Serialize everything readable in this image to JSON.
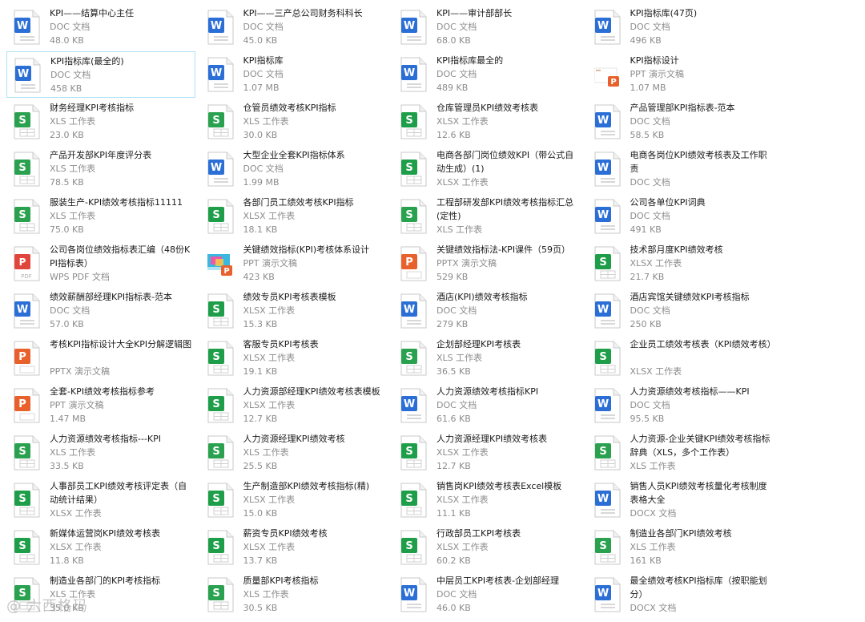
{
  "files": [
    {
      "name": "KPI——结算中心主任",
      "type": "DOC 文档",
      "size": "48.0 KB",
      "icon": "word-icon"
    },
    {
      "name": "KPI——三产总公司财务科科长",
      "type": "DOC 文档",
      "size": "45.0 KB",
      "icon": "word-icon"
    },
    {
      "name": "KPI——审计部部长",
      "type": "DOC 文档",
      "size": "68.0 KB",
      "icon": "word-icon"
    },
    {
      "name": "KPI指标库(47页)",
      "type": "DOC 文档",
      "size": "496 KB",
      "icon": "word-icon"
    },
    {
      "name": "KPI指标库(最全的)",
      "type": "DOC 文档",
      "size": "458 KB",
      "icon": "word-icon",
      "selected": true
    },
    {
      "name": "KPI指标库",
      "type": "DOC 文档",
      "size": "1.07 MB",
      "icon": "word-icon"
    },
    {
      "name": "KPI指标库最全的",
      "type": "DOC 文档",
      "size": "489 KB",
      "icon": "word-icon"
    },
    {
      "name": "KPI指标设计",
      "type": "PPT 演示文稿",
      "size": "1.07 MB",
      "icon": "ppt-thumb-icon"
    },
    {
      "name": "财务经理KPI考核指标",
      "type": "XLS 工作表",
      "size": "23.0 KB",
      "icon": "excel-icon"
    },
    {
      "name": "仓管员绩效考核KPI指标",
      "type": "XLS 工作表",
      "size": "30.0 KB",
      "icon": "excel-icon"
    },
    {
      "name": "仓库管理员KPI绩效考核表",
      "type": "XLSX 工作表",
      "size": "12.6 KB",
      "icon": "excel-green-icon"
    },
    {
      "name": "产品管理部KPI指标表-范本",
      "type": "DOC 文档",
      "size": "58.5 KB",
      "icon": "word-icon"
    },
    {
      "name": "产品开发部KPI年度评分表",
      "type": "XLS 工作表",
      "size": "78.5 KB",
      "icon": "excel-icon"
    },
    {
      "name": "大型企业全套KPI指标体系",
      "type": "DOC 文档",
      "size": "1.99 MB",
      "icon": "word-icon"
    },
    {
      "name": "电商各部门岗位绩效KPI（带公式自动生成）(1)",
      "type": "XLSX 工作表",
      "size": "",
      "icon": "excel-green-icon"
    },
    {
      "name": "电商各岗位KPI绩效考核表及工作职责",
      "type": "DOC 文档",
      "size": "",
      "icon": "word-icon"
    },
    {
      "name": "服装生产-KPI绩效考核指标11111",
      "type": "XLS 工作表",
      "size": "75.0 KB",
      "icon": "excel-icon"
    },
    {
      "name": "各部门员工绩效考核KPI指标",
      "type": "XLSX 工作表",
      "size": "18.1 KB",
      "icon": "excel-green-icon"
    },
    {
      "name": "工程部研发部KPI绩效考核指标汇总(定性)",
      "type": "XLS 工作表",
      "size": "",
      "icon": "excel-icon"
    },
    {
      "name": "公司各单位KPI词典",
      "type": "DOC 文档",
      "size": "491 KB",
      "icon": "word-icon"
    },
    {
      "name": "公司各岗位绩效指标表汇编（48份KPI指标表）",
      "type": "WPS PDF 文档",
      "size": "",
      "icon": "pdf-icon"
    },
    {
      "name": "关键绩效指标(KPI)考核体系设计",
      "type": "PPT 演示文稿",
      "size": "423 KB",
      "icon": "ppt-thumb2-icon"
    },
    {
      "name": "关键绩效指标法-KPI课件（59页）",
      "type": "PPTX 演示文稿",
      "size": "529 KB",
      "icon": "pptx-icon"
    },
    {
      "name": "技术部月度KPI绩效考核",
      "type": "XLSX 工作表",
      "size": "21.7 KB",
      "icon": "excel-green-icon"
    },
    {
      "name": "绩效薪酬部经理KPI指标表-范本",
      "type": "DOC 文档",
      "size": "57.0 KB",
      "icon": "word-icon"
    },
    {
      "name": "绩效专员KPI考核表模板",
      "type": "XLSX 工作表",
      "size": "15.3 KB",
      "icon": "excel-green-icon"
    },
    {
      "name": "酒店(KPI)绩效考核指标",
      "type": "DOC 文档",
      "size": "279 KB",
      "icon": "word-icon"
    },
    {
      "name": "酒店宾馆关键绩效KPI考核指标",
      "type": "DOC 文档",
      "size": "250 KB",
      "icon": "word-icon"
    },
    {
      "name": "考核KPI指标设计大全KPI分解逻辑图",
      "type": "PPTX 演示文稿",
      "size": "",
      "icon": "pptx-icon"
    },
    {
      "name": "客服专员KPI考核表",
      "type": "XLSX 工作表",
      "size": "19.1 KB",
      "icon": "excel-green-icon"
    },
    {
      "name": "企划部经理KPI考核表",
      "type": "XLS 工作表",
      "size": "36.5 KB",
      "icon": "excel-icon"
    },
    {
      "name": "企业员工绩效考核表（KPI绩效考核）",
      "type": "XLSX 工作表",
      "size": "",
      "icon": "excel-green-icon"
    },
    {
      "name": "全套-KPI绩效考核指标参考",
      "type": "PPT 演示文稿",
      "size": "1.47 MB",
      "icon": "ppt-icon"
    },
    {
      "name": "人力资源部经理KPI绩效考核表模板",
      "type": "XLSX 工作表",
      "size": "12.7 KB",
      "icon": "excel-green-icon"
    },
    {
      "name": "人力资源绩效考核指标KPI",
      "type": "DOC 文档",
      "size": "61.6 KB",
      "icon": "word-icon"
    },
    {
      "name": "人力资源绩效考核指标——KPI",
      "type": "DOC 文档",
      "size": "95.5 KB",
      "icon": "word-icon"
    },
    {
      "name": "人力资源绩效考核指标---KPI",
      "type": "XLS 工作表",
      "size": "33.5 KB",
      "icon": "excel-icon"
    },
    {
      "name": "人力资源经理KPI绩效考核",
      "type": "XLS 工作表",
      "size": "25.5 KB",
      "icon": "excel-icon"
    },
    {
      "name": "人力资源经理KPI绩效考核表",
      "type": "XLSX 工作表",
      "size": "12.7 KB",
      "icon": "excel-green-icon"
    },
    {
      "name": "人力资源-企业关键KPI绩效考核指标辞典（XLS，多个工作表）",
      "type": "XLS 工作表",
      "size": "",
      "icon": "excel-icon"
    },
    {
      "name": "人事部员工KPI绩效考核评定表（自动统计结果）",
      "type": "XLSX 工作表",
      "size": "",
      "icon": "excel-green-icon"
    },
    {
      "name": "生产制造部KPI绩效考核指标(精)",
      "type": "XLSX 工作表",
      "size": "15.0 KB",
      "icon": "excel-green-icon"
    },
    {
      "name": "销售岗KPI绩效考核表Excel模板",
      "type": "XLSX 工作表",
      "size": "11.1 KB",
      "icon": "excel-green-icon"
    },
    {
      "name": "销售人员KPI绩效考核量化考核制度表格大全",
      "type": "DOCX 文档",
      "size": "",
      "icon": "docx-icon"
    },
    {
      "name": "新媒体运营岗KPI绩效考核表",
      "type": "XLSX 工作表",
      "size": "11.8 KB",
      "icon": "excel-green-icon"
    },
    {
      "name": "薪资专员KPI绩效考核",
      "type": "XLSX 工作表",
      "size": "13.7 KB",
      "icon": "excel-green-icon"
    },
    {
      "name": "行政部员工KPI考核表",
      "type": "XLSX 工作表",
      "size": "60.2 KB",
      "icon": "excel-green-icon"
    },
    {
      "name": "制造业各部门KPI绩效考核",
      "type": "XLS 工作表",
      "size": "161 KB",
      "icon": "excel-icon"
    },
    {
      "name": "制造业各部门的KPI考核指标",
      "type": "XLS 工作表",
      "size": "35.0 KB",
      "icon": "excel-icon"
    },
    {
      "name": "质量部KPI考核指标",
      "type": "XLS 工作表",
      "size": "30.5 KB",
      "icon": "excel-icon"
    },
    {
      "name": "中层员工KPI考核表-企划部经理",
      "type": "DOC 文档",
      "size": "46.0 KB",
      "icon": "word-icon"
    },
    {
      "name": "最全绩效考核KPI指标库（按职能划分）",
      "type": "DOCX 文档",
      "size": "",
      "icon": "docx-icon"
    }
  ],
  "watermark": "@ 六西格玛",
  "colors": {
    "word": "#2b6fd6",
    "excel": "#1f9e4a",
    "ppt": "#e8612c",
    "pdf": "#e0463c",
    "selection_border": "#aee2f6"
  }
}
